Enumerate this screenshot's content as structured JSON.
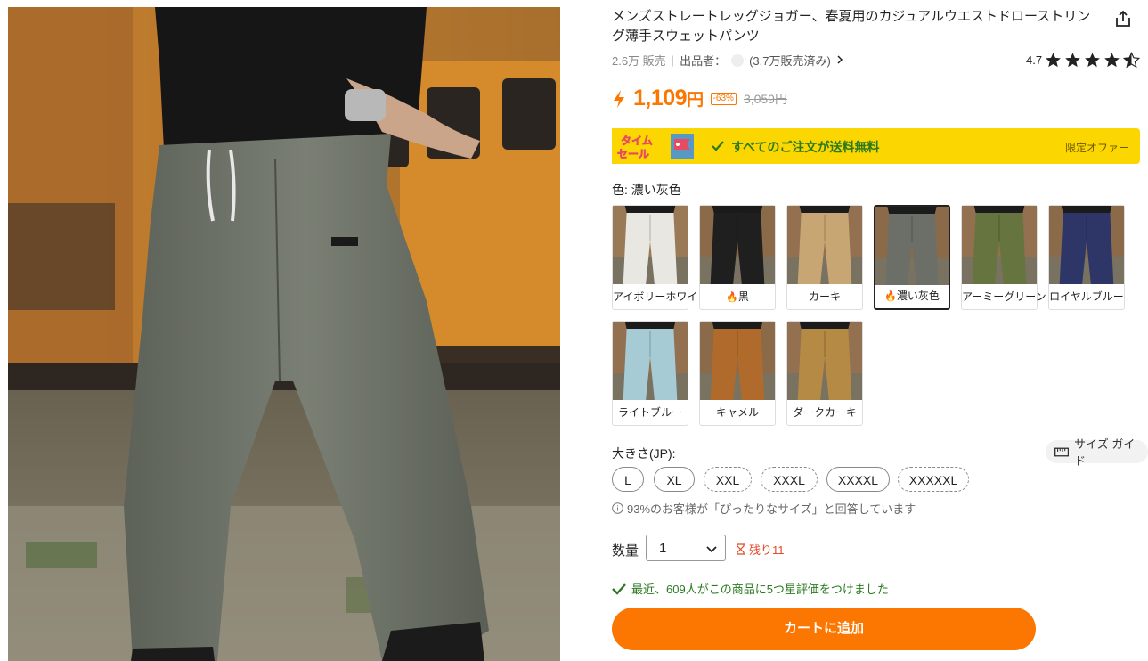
{
  "product": {
    "title": "メンズストレートレッグジョガー、春夏用のカジュアルウエストドローストリング薄手スウェットパンツ",
    "sales": "2.6万 販売",
    "seller_label": "出品者：",
    "seller_icon": "··",
    "seller_sales": "(3.7万販売済み)",
    "rating_value": "4.7",
    "rating_stars": 4.5
  },
  "price": {
    "current": "1,109",
    "yen": "円",
    "discount": "-63%",
    "original": "3,059円"
  },
  "promo": {
    "badge_line1": "タイム",
    "badge_line2": "セール",
    "message": "すべてのご注文が送料無料",
    "limited": "限定オファー",
    "color": "#fbd600"
  },
  "color_section": {
    "label": "色: 濃い灰色",
    "options": [
      {
        "name": "アイボリーホワイト",
        "hot": false,
        "selected": false,
        "swatch": "#e9e7e1",
        "bg": "#9a7a56"
      },
      {
        "name": "黒",
        "hot": true,
        "selected": false,
        "swatch": "#1e1f1e",
        "bg": "#8a6a48"
      },
      {
        "name": "カーキ",
        "hot": false,
        "selected": false,
        "swatch": "#c8a673",
        "bg": "#927050"
      },
      {
        "name": "濃い灰色",
        "hot": true,
        "selected": true,
        "swatch": "#6c6f68",
        "bg": "#8a6a48"
      },
      {
        "name": "アーミーグリーン",
        "hot": false,
        "selected": false,
        "swatch": "#66753f",
        "bg": "#927050"
      },
      {
        "name": "ロイヤルブルー",
        "hot": false,
        "selected": false,
        "swatch": "#2e3668",
        "bg": "#8a6a48"
      },
      {
        "name": "ライトブルー",
        "hot": false,
        "selected": false,
        "swatch": "#a7cbd4",
        "bg": "#927050"
      },
      {
        "name": "キャメル",
        "hot": false,
        "selected": false,
        "swatch": "#b06b2c",
        "bg": "#8a6a48"
      },
      {
        "name": "ダークカーキ",
        "hot": false,
        "selected": false,
        "swatch": "#b58a45",
        "bg": "#927050"
      }
    ]
  },
  "size_section": {
    "label": "大きさ(JP):",
    "guide": "サイズ ガイド",
    "sizes": [
      {
        "name": "L",
        "low_stock": false
      },
      {
        "name": "XL",
        "low_stock": false
      },
      {
        "name": "XXL",
        "low_stock": true
      },
      {
        "name": "XXXL",
        "low_stock": true
      },
      {
        "name": "XXXXL",
        "low_stock": false
      },
      {
        "name": "XXXXXL",
        "low_stock": true
      }
    ],
    "fit_note": "93%のお客様が「ぴったりなサイズ」と回答しています"
  },
  "quantity": {
    "label": "数量",
    "value": "1",
    "stock_note": "残り11"
  },
  "review_note": "最近、609人がこの商品に5つ星評価をつけました",
  "cart_button": "カートに追加",
  "colors": {
    "accent": "#fb7701",
    "green": "#2a7a1f"
  }
}
